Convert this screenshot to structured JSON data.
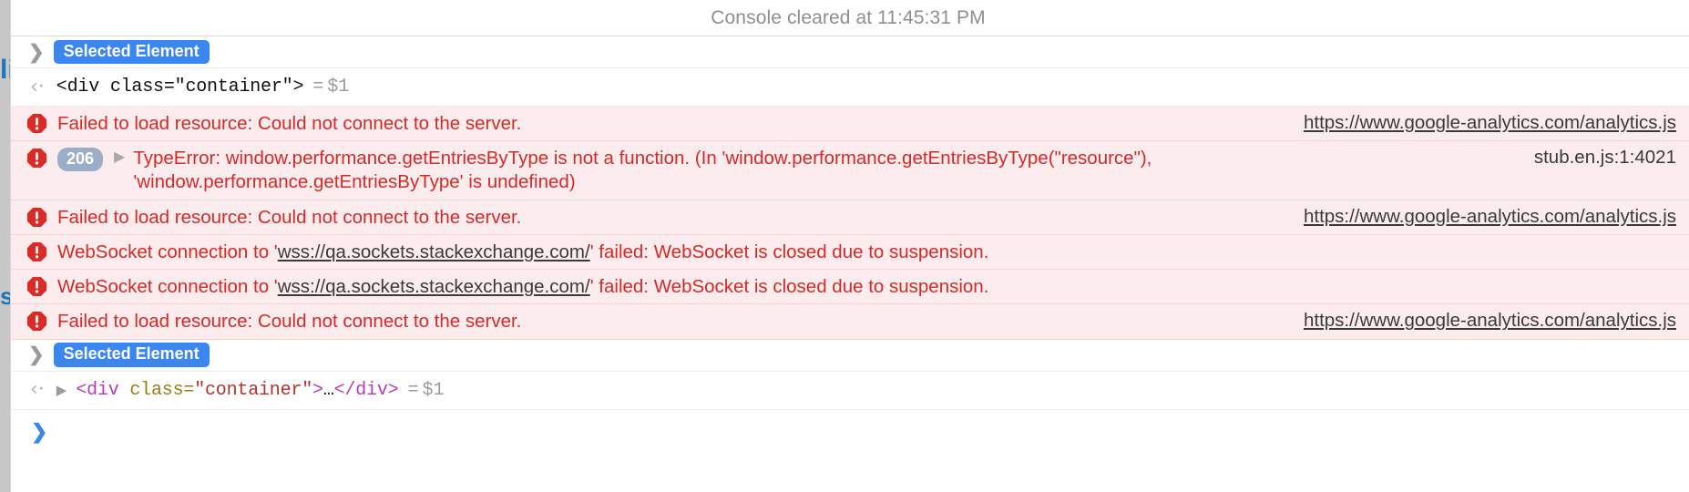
{
  "panel": {
    "cleared_banner": "Console cleared at 11:45:31 PM",
    "background": "#ffffff",
    "error_row_background": "#fdeced",
    "error_text_color": "#d62a28",
    "accent_blue": "#3b87f0",
    "badge_color": "#9aaec9"
  },
  "page_behind": {
    "fragment_top": "li",
    "fragment_bottom": "s",
    "color": "#1b75bb"
  },
  "rows": [
    {
      "type": "selected-element",
      "chevron_icon": "chevron-right-icon",
      "label": "Selected Element"
    },
    {
      "type": "result",
      "back_icon": "result-arrow-icon",
      "expandable": false,
      "code": {
        "open_tag": "<div",
        "space": " ",
        "attr_name": "class=",
        "attr_value": "\"container\"",
        "close_bracket": ">",
        "ellipsis": "",
        "end_tag": ""
      },
      "equals": "=",
      "variable": "$1"
    },
    {
      "type": "error",
      "icon": "error-octagon-icon",
      "count": null,
      "expandable": false,
      "message": "Failed to load resource: Could not connect to the server.",
      "source": "https://www.google-analytics.com/analytics.js",
      "source_underlined": true
    },
    {
      "type": "error",
      "icon": "error-octagon-icon",
      "count": "206",
      "expandable": true,
      "disclosure_icon": "triangle-right-icon",
      "message_line1": "TypeError: window.performance.getEntriesByType is not a function. (In 'window.performance.getEntriesByType(\"resource\"),",
      "message_line2": "'window.performance.getEntriesByType' is undefined)",
      "message": "TypeError: window.performance.getEntriesByType is not a function. (In 'window.performance.getEntriesByType(\"resource\"), 'window.performance.getEntriesByType' is undefined)",
      "source": "stub.en.js:1:4021",
      "source_underlined": false
    },
    {
      "type": "error",
      "icon": "error-octagon-icon",
      "count": null,
      "expandable": false,
      "message": "Failed to load resource: Could not connect to the server.",
      "source": "https://www.google-analytics.com/analytics.js",
      "source_underlined": true
    },
    {
      "type": "error-link",
      "icon": "error-octagon-icon",
      "prefix": "WebSocket connection to '",
      "link": "wss://qa.sockets.stackexchange.com/",
      "suffix": "' failed: WebSocket is closed due to suspension.",
      "source": ""
    },
    {
      "type": "error-link",
      "icon": "error-octagon-icon",
      "prefix": "WebSocket connection to '",
      "link": "wss://qa.sockets.stackexchange.com/",
      "suffix": "' failed: WebSocket is closed due to suspension.",
      "source": ""
    },
    {
      "type": "error",
      "icon": "error-octagon-icon",
      "count": null,
      "expandable": false,
      "message": "Failed to load resource: Could not connect to the server.",
      "source": "https://www.google-analytics.com/analytics.js",
      "source_underlined": true
    },
    {
      "type": "selected-element",
      "chevron_icon": "chevron-right-icon",
      "label": "Selected Element"
    },
    {
      "type": "result",
      "back_icon": "result-arrow-icon",
      "expandable": true,
      "disclosure_icon": "triangle-right-icon",
      "code": {
        "open_tag": "<div",
        "space": " ",
        "attr_name": "class=",
        "attr_value": "\"container\"",
        "close_bracket": ">",
        "ellipsis": "…",
        "end_tag": "</div>"
      },
      "equals": "=",
      "variable": "$1"
    }
  ],
  "prompt": {
    "chevron": "❯"
  }
}
